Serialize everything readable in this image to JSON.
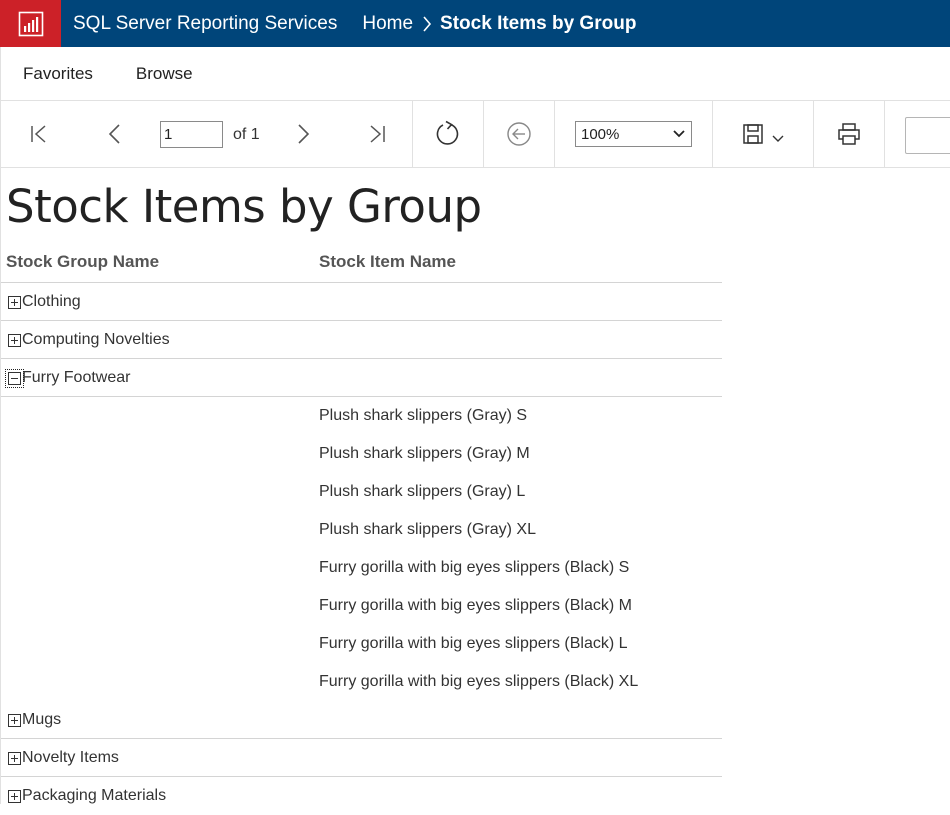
{
  "header": {
    "app_title": "SQL Server Reporting Services",
    "breadcrumb_home": "Home",
    "breadcrumb_current": "Stock Items by Group",
    "logo_color": "#cc2128",
    "bar_color": "#00457a"
  },
  "nav": {
    "favorites": "Favorites",
    "browse": "Browse"
  },
  "toolbar": {
    "page_value": "1",
    "of_label": "of 1",
    "zoom_value": "100%"
  },
  "report": {
    "title": "Stock Items by Group",
    "col_group": "Stock Group Name",
    "col_item": "Stock Item Name",
    "groups": [
      {
        "name": "Clothing",
        "expanded": false
      },
      {
        "name": "Computing Novelties",
        "expanded": false
      },
      {
        "name": "Furry Footwear",
        "expanded": true
      },
      {
        "name": "Mugs",
        "expanded": false
      },
      {
        "name": "Novelty Items",
        "expanded": false
      },
      {
        "name": "Packaging Materials",
        "expanded": false
      }
    ],
    "items": [
      "Plush shark slippers (Gray) S",
      "Plush shark slippers (Gray) M",
      "Plush shark slippers (Gray) L",
      "Plush shark slippers (Gray) XL",
      "Furry gorilla with big eyes slippers (Black) S",
      "Furry gorilla with big eyes slippers (Black) M",
      "Furry gorilla with big eyes slippers (Black) L",
      "Furry gorilla with big eyes slippers (Black) XL"
    ]
  }
}
